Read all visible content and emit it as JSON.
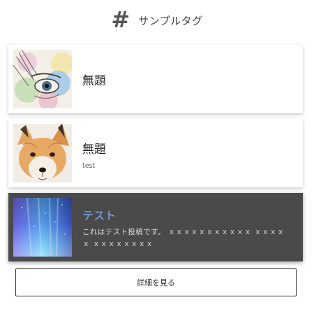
{
  "header": {
    "icon": "hash-icon",
    "tag_name": "サンプルタグ"
  },
  "posts": [
    {
      "title": "無題",
      "description": "",
      "thumbnail": "watercolor-eye-image",
      "active": false
    },
    {
      "title": "無題",
      "description": "test",
      "thumbnail": "fox-pup-image",
      "active": false
    },
    {
      "title": "テスト",
      "description": "これはテスト投稿です。 ｘｘｘｘｘｘｘｘｘｘｘ ｘｘｘｘｘ ｘｘｘｘｘｘｘｘ",
      "thumbnail": "aurora-image",
      "active": true
    }
  ],
  "more_button": {
    "label": "詳細を見る"
  },
  "colors": {
    "active_card_bg": "#4a4a4a",
    "active_title": "#8ab0f5"
  }
}
